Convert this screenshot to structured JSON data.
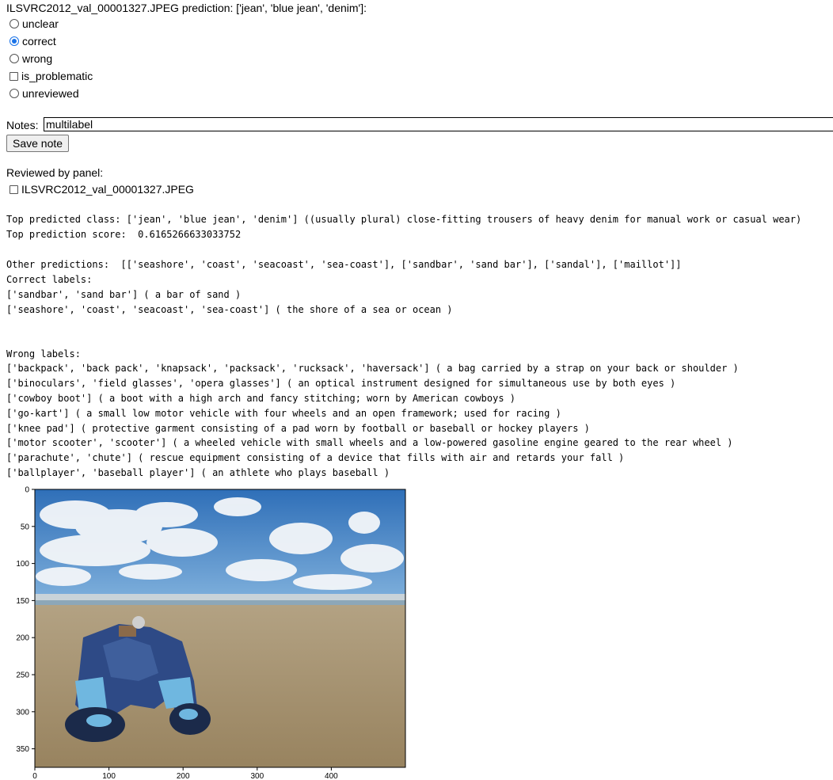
{
  "header": "ILSVRC2012_val_00001327.JPEG prediction: ['jean', 'blue jean', 'denim']:",
  "options": [
    {
      "label": "unclear",
      "type": "radio",
      "checked": false
    },
    {
      "label": "correct",
      "type": "radio",
      "checked": true
    },
    {
      "label": "wrong",
      "type": "radio",
      "checked": false
    },
    {
      "label": "is_problematic",
      "type": "checkbox",
      "checked": false
    },
    {
      "label": "unreviewed",
      "type": "radio",
      "checked": false
    }
  ],
  "notes": {
    "label": "Notes:",
    "value": "multilabel"
  },
  "save_button": "Save note",
  "reviewed": {
    "label": "Reviewed by panel:",
    "item": "ILSVRC2012_val_00001327.JPEG"
  },
  "top_class_line": "Top predicted class: ['jean', 'blue jean', 'denim'] ((usually plural) close-fitting trousers of heavy denim for manual work or casual wear)",
  "top_score_line": "Top prediction score:  0.6165266633033752",
  "other_predictions_line": "Other predictions:  [['seashore', 'coast', 'seacoast', 'sea-coast'], ['sandbar', 'sand bar'], ['sandal'], ['maillot']]",
  "correct_labels_title": "Correct labels:",
  "correct_labels": [
    "['sandbar', 'sand bar'] ( a bar of sand )",
    "['seashore', 'coast', 'seacoast', 'sea-coast'] ( the shore of a sea or ocean )"
  ],
  "wrong_labels_title": "Wrong labels:",
  "wrong_labels": [
    "['backpack', 'back pack', 'knapsack', 'packsack', 'rucksack', 'haversack'] ( a bag carried by a strap on your back or shoulder )",
    "['binoculars', 'field glasses', 'opera glasses'] ( an optical instrument designed for simultaneous use by both eyes )",
    "['cowboy boot'] ( a boot with a high arch and fancy stitching; worn by American cowboys )",
    "['go-kart'] ( a small low motor vehicle with four wheels and an open framework; used for racing )",
    "['knee pad'] ( protective garment consisting of a pad worn by football or baseball or hockey players )",
    "['motor scooter', 'scooter'] ( a wheeled vehicle with small wheels and a low-powered gasoline engine geared to the rear wheel )",
    "['parachute', 'chute'] ( rescue equipment consisting of a device that fills with air and retards your fall )",
    "['ballplayer', 'baseball player'] ( an athlete who plays baseball )"
  ],
  "image_plot": {
    "x_ticks": [
      "0",
      "100",
      "200",
      "300",
      "400"
    ],
    "y_ticks": [
      "0",
      "50",
      "100",
      "150",
      "200",
      "250",
      "300",
      "350"
    ],
    "x_range": [
      0,
      500
    ],
    "y_range": [
      0,
      375
    ],
    "colors": {
      "sky": "#4a86c9",
      "cloud": "#f2f5f8",
      "sand": "#a3906f",
      "jeans": "#2e4a86",
      "sea": "#8da7b8"
    }
  }
}
